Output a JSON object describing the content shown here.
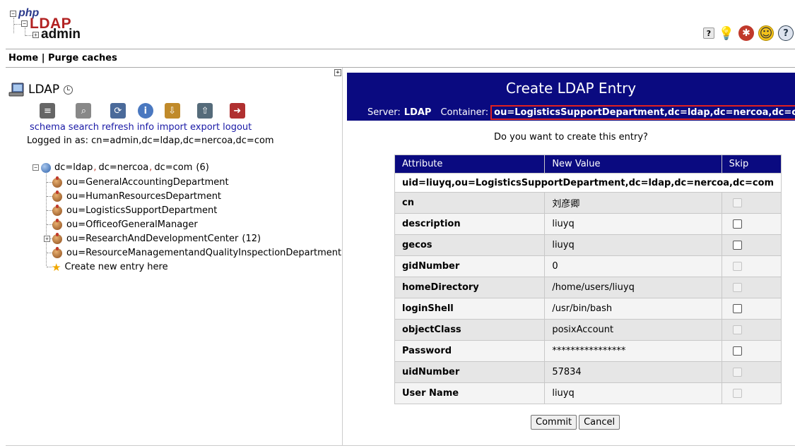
{
  "app": {
    "logo": {
      "php": "php",
      "ldap": "LDAP",
      "admin": "admin"
    }
  },
  "top_icons": [
    {
      "name": "help-icon",
      "glyph": "?"
    },
    {
      "name": "lightbulb-icon",
      "glyph": "💡"
    },
    {
      "name": "bug-icon",
      "glyph": "✱"
    },
    {
      "name": "smiley-icon",
      "glyph": "☺"
    },
    {
      "name": "question-icon",
      "glyph": "?"
    }
  ],
  "nav": {
    "home": "Home",
    "separator": "|",
    "purge": "Purge caches"
  },
  "left": {
    "server_name": "LDAP",
    "toolbar": [
      {
        "name": "schema",
        "label": "schema",
        "icon": "document-icon",
        "color": "#666666"
      },
      {
        "name": "search",
        "label": "search",
        "icon": "magnifier-icon",
        "color": "#888888"
      },
      {
        "name": "refresh",
        "label": "refresh",
        "icon": "refresh-icon",
        "color": "#4a6a9a"
      },
      {
        "name": "info",
        "label": "info",
        "icon": "info-icon",
        "color": "#4a78c0"
      },
      {
        "name": "import",
        "label": "import",
        "icon": "import-icon",
        "color": "#c08a2a"
      },
      {
        "name": "export",
        "label": "export",
        "icon": "export-icon",
        "color": "#556b7a"
      },
      {
        "name": "logout",
        "label": "logout",
        "icon": "logout-icon",
        "color": "#b03030"
      }
    ],
    "logged_in": "Logged in as: cn=admin,dc=ldap,dc=nercoa,dc=com",
    "tree": {
      "root_pre": "dc=ldap",
      "root_mid": "dc=nercoa",
      "root_end": "dc=com",
      "root_count": "(6)",
      "sep": ",",
      "children": [
        {
          "label": "ou=GeneralAccountingDepartment",
          "expandable": false,
          "count": ""
        },
        {
          "label": "ou=HumanResourcesDepartment",
          "expandable": false,
          "count": ""
        },
        {
          "label": "ou=LogisticsSupportDepartment",
          "expandable": false,
          "count": ""
        },
        {
          "label": "ou=OfficeofGeneralManager",
          "expandable": false,
          "count": ""
        },
        {
          "label": "ou=ResearchAndDevelopmentCenter",
          "expandable": true,
          "count": "(12)"
        },
        {
          "label": "ou=ResourceManagementandQualityInspectionDepartment",
          "expandable": false,
          "count": ""
        }
      ],
      "create_new": "Create new entry here"
    }
  },
  "right": {
    "title": "Create LDAP Entry",
    "server_label": "Server:",
    "server_value": "LDAP",
    "container_label": "Container:",
    "container_value": "ou=LogisticsSupportDepartment,dc=ldap,dc=nercoa,dc=com",
    "question": "Do you want to create this entry?",
    "table": {
      "headers": [
        "Attribute",
        "New Value",
        "Skip"
      ],
      "dn": "uid=liuyq,ou=LogisticsSupportDepartment,dc=ldap,dc=nercoa,dc=com",
      "rows": [
        {
          "attr": "cn",
          "value": "刘彦卿",
          "skippable": false
        },
        {
          "attr": "description",
          "value": "liuyq",
          "skippable": true
        },
        {
          "attr": "gecos",
          "value": "liuyq",
          "skippable": true
        },
        {
          "attr": "gidNumber",
          "value": "0",
          "skippable": false
        },
        {
          "attr": "homeDirectory",
          "value": "/home/users/liuyq",
          "skippable": false
        },
        {
          "attr": "loginShell",
          "value": "/usr/bin/bash",
          "skippable": true
        },
        {
          "attr": "objectClass",
          "value": "posixAccount",
          "skippable": false
        },
        {
          "attr": "Password",
          "value": "****************",
          "skippable": true
        },
        {
          "attr": "uidNumber",
          "value": "57834",
          "skippable": false
        },
        {
          "attr": "User Name",
          "value": "liuyq",
          "skippable": false
        }
      ]
    },
    "commit": "Commit",
    "cancel": "Cancel"
  }
}
